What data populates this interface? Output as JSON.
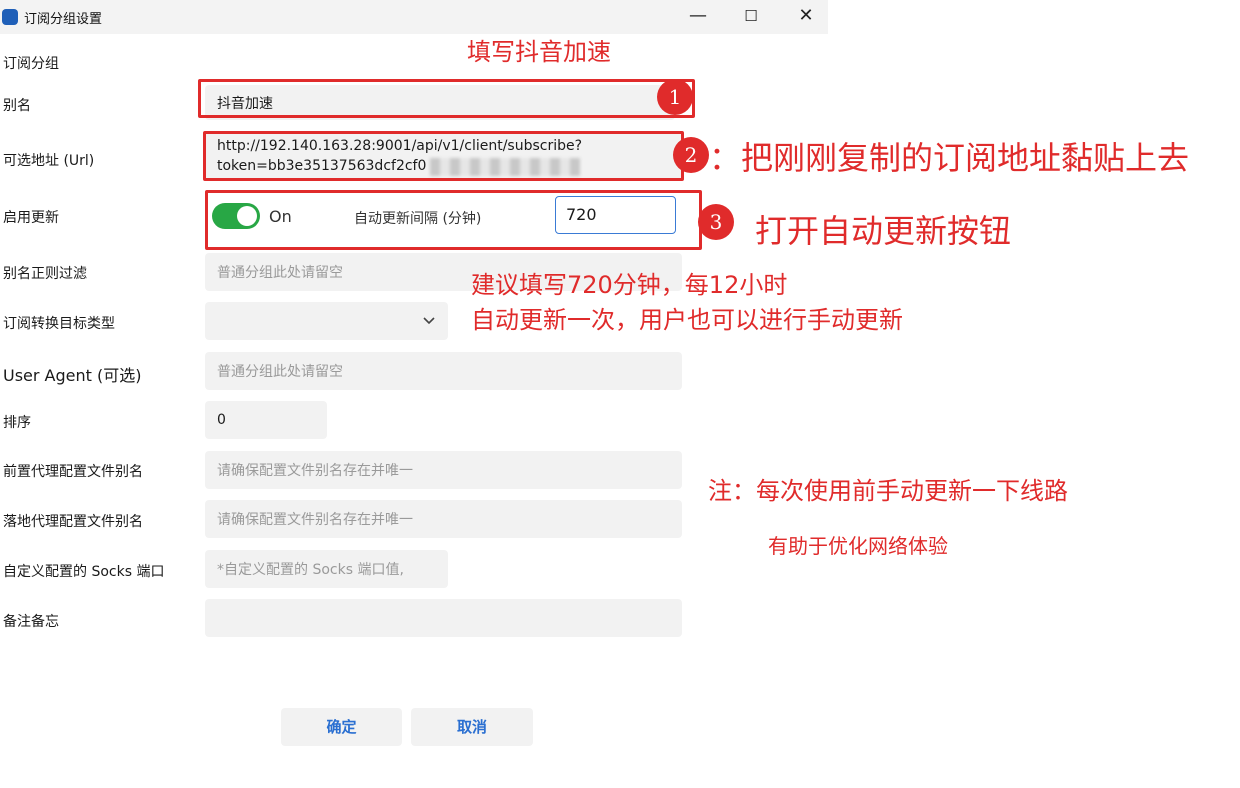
{
  "window": {
    "title": "订阅分组设置",
    "minimize_glyph": "—",
    "maximize_glyph": "☐",
    "close_glyph": "✕",
    "app_icon": "app-logo-icon"
  },
  "section_title": "订阅分组",
  "form": {
    "alias": {
      "label": "别名",
      "value": "抖音加速"
    },
    "url": {
      "label": "可选地址 (Url)",
      "line1": "http://192.140.163.28:9001/api/v1/client/subscribe?",
      "line2": "token=bb3e35137563dcf2cf0"
    },
    "update": {
      "label": "启用更新",
      "toggle_state": "On",
      "interval_label": "自动更新间隔 (分钟)",
      "interval_value": "720"
    },
    "alias_filter": {
      "label": "别名正则过滤",
      "placeholder": "普通分组此处请留空"
    },
    "convert_target": {
      "label": "订阅转换目标类型",
      "value": ""
    },
    "user_agent": {
      "label": "User Agent (可选)",
      "placeholder": "普通分组此处请留空"
    },
    "sort": {
      "label": "排序",
      "value": "0"
    },
    "pre_proxy": {
      "label": "前置代理配置文件别名",
      "placeholder": "请确保配置文件别名存在并唯一"
    },
    "landing_proxy": {
      "label": "落地代理配置文件别名",
      "placeholder": "请确保配置文件别名存在并唯一"
    },
    "socks_port": {
      "label": "自定义配置的 Socks 端口",
      "placeholder": "*自定义配置的 Socks 端口值,"
    },
    "remarks": {
      "label": "备注备忘",
      "value": ""
    }
  },
  "buttons": {
    "confirm": "确定",
    "cancel": "取消"
  },
  "annotations": {
    "top": "填写抖音加速",
    "n1": "1",
    "n2": "2",
    "n3": "3",
    "step2": "：把刚刚复制的订阅地址黏贴上去",
    "step3": "打开自动更新按钮",
    "suggest1": "建议填写720分钟，每12小时",
    "suggest2": "自动更新一次，用户也可以进行手动更新",
    "note1": "注：每次使用前手动更新一下线路",
    "note2": "有助于优化网络体验"
  },
  "colors": {
    "annotation_red": "#e02b2b",
    "toggle_green": "#28a745",
    "button_text": "#2a6fd1",
    "field_bg": "#f2f2f2"
  }
}
